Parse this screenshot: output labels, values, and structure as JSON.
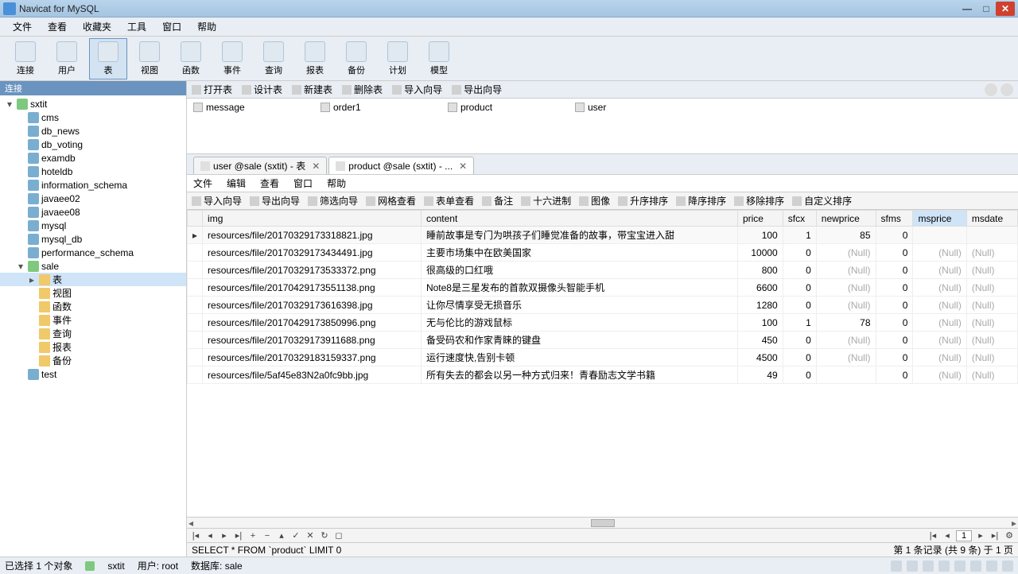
{
  "window": {
    "title": "Navicat for MySQL"
  },
  "menus": [
    "文件",
    "查看",
    "收藏夹",
    "工具",
    "窗口",
    "帮助"
  ],
  "toolbar": [
    {
      "label": "连接",
      "name": "tool-connect"
    },
    {
      "label": "用户",
      "name": "tool-user"
    },
    {
      "label": "表",
      "name": "tool-table",
      "active": true
    },
    {
      "label": "视图",
      "name": "tool-view"
    },
    {
      "label": "函数",
      "name": "tool-function"
    },
    {
      "label": "事件",
      "name": "tool-event"
    },
    {
      "label": "查询",
      "name": "tool-query"
    },
    {
      "label": "报表",
      "name": "tool-report"
    },
    {
      "label": "备份",
      "name": "tool-backup"
    },
    {
      "label": "计划",
      "name": "tool-schedule"
    },
    {
      "label": "模型",
      "name": "tool-model"
    }
  ],
  "sidebar": {
    "header": "连接",
    "connection": "sxtit",
    "databases": [
      "cms",
      "db_news",
      "db_voting",
      "examdb",
      "hoteldb",
      "information_schema",
      "javaee02",
      "javaee08",
      "mysql",
      "mysql_db",
      "performance_schema"
    ],
    "openDb": "sale",
    "openDbChildren": [
      "表",
      "视图",
      "函数",
      "事件",
      "查询",
      "报表",
      "备份"
    ],
    "trailing": [
      "test"
    ]
  },
  "contentToolbar": [
    "打开表",
    "设计表",
    "新建表",
    "删除表",
    "导入向导",
    "导出向导"
  ],
  "objects": [
    "message",
    "order1",
    "product",
    "user"
  ],
  "tabs": [
    {
      "label": "user @sale (sxtit) - 表",
      "active": false
    },
    {
      "label": "product @sale (sxtit) - ...",
      "active": true
    }
  ],
  "subMenu": [
    "文件",
    "编辑",
    "查看",
    "窗口",
    "帮助"
  ],
  "gridToolbar": [
    "导入向导",
    "导出向导",
    "筛选向导",
    "网格查看",
    "表单查看",
    "备注",
    "十六进制",
    "图像",
    "升序排序",
    "降序排序",
    "移除排序",
    "自定义排序"
  ],
  "columns": [
    "",
    "img",
    "content",
    "price",
    "sfcx",
    "newprice",
    "sfms",
    "msprice",
    "msdate"
  ],
  "highlightCol": 7,
  "rows": [
    {
      "img": "resources/file/20170329173318821.jpg",
      "content": "睡前故事是专门为哄孩子们睡觉准备的故事，带宝宝进入甜",
      "price": "100",
      "sfcx": "1",
      "newprice": "85",
      "sfms": "0",
      "msprice": "",
      "msdate": "",
      "current": true
    },
    {
      "img": "resources/file/20170329173434491.jpg",
      "content": "主要市场集中在欧美国家",
      "price": "10000",
      "sfcx": "0",
      "newprice": "(Null)",
      "sfms": "0",
      "msprice": "(Null)",
      "msdate": "(Null)"
    },
    {
      "img": "resources/file/20170329173533372.png",
      "content": "很高级的口红哦",
      "price": "800",
      "sfcx": "0",
      "newprice": "(Null)",
      "sfms": "0",
      "msprice": "(Null)",
      "msdate": "(Null)"
    },
    {
      "img": "resources/file/20170429173551138.png",
      "content": "Note8是三星发布的首款双摄像头智能手机",
      "price": "6600",
      "sfcx": "0",
      "newprice": "(Null)",
      "sfms": "0",
      "msprice": "(Null)",
      "msdate": "(Null)"
    },
    {
      "img": "resources/file/20170329173616398.jpg",
      "content": "让你尽情享受无损音乐",
      "price": "1280",
      "sfcx": "0",
      "newprice": "(Null)",
      "sfms": "0",
      "msprice": "(Null)",
      "msdate": "(Null)"
    },
    {
      "img": "resources/file/20170429173850996.png",
      "content": "无与伦比的游戏鼠标",
      "price": "100",
      "sfcx": "1",
      "newprice": "78",
      "sfms": "0",
      "msprice": "(Null)",
      "msdate": "(Null)"
    },
    {
      "img": "resources/file/20170329173911688.png",
      "content": "备受码农和作家青睐的键盘",
      "price": "450",
      "sfcx": "0",
      "newprice": "(Null)",
      "sfms": "0",
      "msprice": "(Null)",
      "msdate": "(Null)"
    },
    {
      "img": "resources/file/20170329183159337.png",
      "content": "运行速度快,告别卡顿",
      "price": "4500",
      "sfcx": "0",
      "newprice": "(Null)",
      "sfms": "0",
      "msprice": "(Null)",
      "msdate": "(Null)"
    },
    {
      "img": "resources/file/5af45e83N2a0fc9bb.jpg",
      "content": "所有失去的都会以另一种方式归来！青春励志文学书籍",
      "price": "49",
      "sfcx": "0",
      "newprice": "",
      "sfms": "0",
      "msprice": "(Null)",
      "msdate": "(Null)"
    }
  ],
  "sql": "SELECT * FROM `product` LIMIT 0",
  "pageInfo": "第 1 条记录 (共 9 条) 于 1 页",
  "pageInput": "1",
  "status": {
    "sel": "已选择 1 个对象",
    "conn": "sxtit",
    "user": "用户: root",
    "db": "数据库: sale"
  }
}
